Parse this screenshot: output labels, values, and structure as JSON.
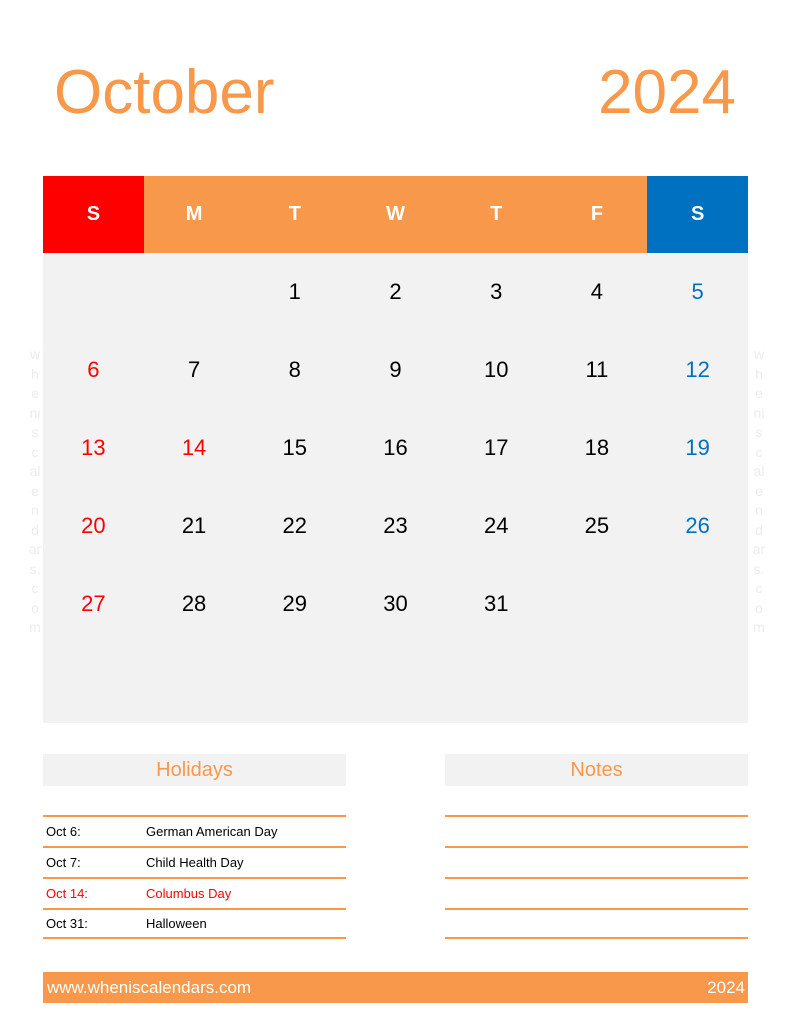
{
  "header": {
    "month": "October",
    "year": "2024"
  },
  "weekdays": [
    {
      "label": "S",
      "type": "sun"
    },
    {
      "label": "M",
      "type": ""
    },
    {
      "label": "T",
      "type": ""
    },
    {
      "label": "W",
      "type": ""
    },
    {
      "label": "T",
      "type": ""
    },
    {
      "label": "F",
      "type": ""
    },
    {
      "label": "S",
      "type": "sat"
    }
  ],
  "days": [
    "",
    "",
    "1",
    "2",
    "3",
    "4",
    "5",
    "6",
    "7",
    "8",
    "9",
    "10",
    "11",
    "12",
    "13",
    "14",
    "15",
    "16",
    "17",
    "18",
    "19",
    "20",
    "21",
    "22",
    "23",
    "24",
    "25",
    "26",
    "27",
    "28",
    "29",
    "30",
    "31",
    "",
    ""
  ],
  "holiday_dates": [
    "14"
  ],
  "watermark": [
    "w",
    "h",
    "e",
    "ni",
    "s",
    "c",
    "al",
    "e",
    "n",
    "d",
    "ar",
    "s.",
    "c",
    "o",
    "m"
  ],
  "holidays": {
    "title": "Holidays",
    "items": [
      {
        "date": "Oct 6:",
        "name": "German American Day",
        "highlight": false
      },
      {
        "date": "Oct 7:",
        "name": "Child Health Day",
        "highlight": false
      },
      {
        "date": "Oct 14:",
        "name": "Columbus Day",
        "highlight": true
      },
      {
        "date": "Oct 31:",
        "name": "Halloween",
        "highlight": false
      }
    ]
  },
  "notes": {
    "title": "Notes",
    "lines": 4
  },
  "footer": {
    "website": "www.wheniscalendars.com",
    "year": "2024"
  },
  "colors": {
    "accent": "#f7984a",
    "sunday": "#ff0000",
    "saturday": "#0070c0",
    "grid_bg": "#f2f2f2"
  }
}
